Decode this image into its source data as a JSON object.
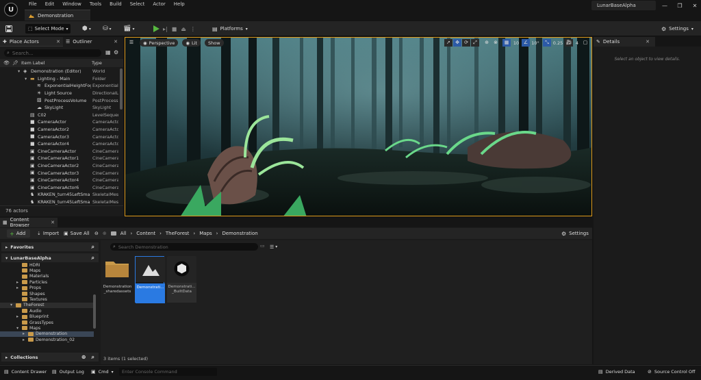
{
  "menu": [
    "File",
    "Edit",
    "Window",
    "Tools",
    "Build",
    "Select",
    "Actor",
    "Help"
  ],
  "doc_tab": "Demonstration",
  "project_name": "LunarBaseAlpha",
  "toolbar": {
    "select_mode": "Select Mode",
    "platforms": "Platforms",
    "settings": "Settings"
  },
  "left_tabs": {
    "place_actors": "Place Actors",
    "outliner": "Outliner"
  },
  "outliner": {
    "search_placeholder": "Search...",
    "col_label": "Item Label",
    "col_type": "Type",
    "rows": [
      {
        "label": "Demonstration (Editor)",
        "type": "World",
        "depth": 0,
        "icon": "world-icon"
      },
      {
        "label": "Lighting - Main",
        "type": "Folder",
        "depth": 1,
        "icon": "folder-icon"
      },
      {
        "label": "ExponentialHeightFog",
        "type": "ExponentialH",
        "depth": 2,
        "icon": "fog-icon"
      },
      {
        "label": "Light Source",
        "type": "DirectionalL",
        "depth": 2,
        "icon": "light-icon"
      },
      {
        "label": "PostProcessVolume",
        "type": "PostProcess",
        "depth": 2,
        "icon": "volume-icon"
      },
      {
        "label": "SkyLight",
        "type": "SkyLight",
        "depth": 2,
        "icon": "skylight-icon"
      },
      {
        "label": "C02",
        "type": "LevelSequen",
        "depth": 1,
        "icon": "sequence-icon"
      },
      {
        "label": "CameraActor",
        "type": "CameraActo",
        "depth": 1,
        "icon": "camera-icon"
      },
      {
        "label": "CameraActor2",
        "type": "CameraActo",
        "depth": 1,
        "icon": "camera-icon"
      },
      {
        "label": "CameraActor3",
        "type": "CameraActo",
        "depth": 1,
        "icon": "camera-icon"
      },
      {
        "label": "CameraActor4",
        "type": "CameraActo",
        "depth": 1,
        "icon": "camera-icon"
      },
      {
        "label": "CineCameraActor",
        "type": "CineCamera",
        "depth": 1,
        "icon": "cine-camera-icon"
      },
      {
        "label": "CineCameraActor1",
        "type": "CineCamera",
        "depth": 1,
        "icon": "cine-camera-icon"
      },
      {
        "label": "CineCameraActor2",
        "type": "CineCamera",
        "depth": 1,
        "icon": "cine-camera-icon"
      },
      {
        "label": "CineCameraActor3",
        "type": "CineCamera",
        "depth": 1,
        "icon": "cine-camera-icon"
      },
      {
        "label": "CineCameraActor4",
        "type": "CineCamera",
        "depth": 1,
        "icon": "cine-camera-icon"
      },
      {
        "label": "CineCameraActor6",
        "type": "CineCamera",
        "depth": 1,
        "icon": "cine-camera-icon"
      },
      {
        "label": "KRAKEN_turn45LeftSma",
        "type": "SkeletalMes",
        "depth": 1,
        "icon": "skeletal-mesh-icon"
      },
      {
        "label": "KRAKEN_turn45LeftSma",
        "type": "SkeletalMes",
        "depth": 1,
        "icon": "skeletal-mesh-icon"
      }
    ],
    "actor_count": "76 actors"
  },
  "viewport": {
    "perspective": "Perspective",
    "lit": "Lit",
    "show": "Show",
    "grid_snap": "10",
    "rotation_snap": "10°",
    "scale_snap": "0.25",
    "camera_speed": "4"
  },
  "details": {
    "tab": "Details",
    "empty_text": "Select an object to view details."
  },
  "content_browser": {
    "tab": "Content Browser",
    "add": "Add",
    "import": "Import",
    "save_all": "Save All",
    "breadcrumb": [
      "All",
      "Content",
      "TheForest",
      "Maps",
      "Demonstration"
    ],
    "settings": "Settings",
    "favorites": "Favorites",
    "project": "LunarBaseAlpha",
    "collections": "Collections",
    "tree": [
      {
        "label": "HDRI",
        "depth": 2,
        "arrow": false,
        "state": ""
      },
      {
        "label": "Maps",
        "depth": 2,
        "arrow": false,
        "state": ""
      },
      {
        "label": "Materials",
        "depth": 2,
        "arrow": false,
        "state": ""
      },
      {
        "label": "Particles",
        "depth": 2,
        "arrow": true,
        "state": ""
      },
      {
        "label": "Props",
        "depth": 2,
        "arrow": true,
        "state": ""
      },
      {
        "label": "Shapes",
        "depth": 2,
        "arrow": false,
        "state": ""
      },
      {
        "label": "Textures",
        "depth": 2,
        "arrow": false,
        "state": ""
      },
      {
        "label": "TheForest",
        "depth": 1,
        "arrow": "open",
        "state": "hl2"
      },
      {
        "label": "Audio",
        "depth": 2,
        "arrow": false,
        "state": ""
      },
      {
        "label": "Blueprint",
        "depth": 2,
        "arrow": true,
        "state": ""
      },
      {
        "label": "GrassTypes",
        "depth": 2,
        "arrow": false,
        "state": ""
      },
      {
        "label": "Maps",
        "depth": 2,
        "arrow": "open",
        "state": ""
      },
      {
        "label": "Demonstration",
        "depth": 3,
        "arrow": true,
        "state": "hl"
      },
      {
        "label": "Demonstration_02",
        "depth": 3,
        "arrow": true,
        "state": ""
      }
    ],
    "search_placeholder": "Search Demonstration",
    "assets": [
      {
        "caption1": "Demonstration",
        "caption2": "_sharedassets",
        "kind": "folder"
      },
      {
        "caption1": "Demonstrati...",
        "caption2": "",
        "kind": "level"
      },
      {
        "caption1": "Demonstrati...",
        "caption2": "_BuiltData",
        "kind": "builtdata"
      }
    ],
    "items_count": "3 items (1 selected)"
  },
  "statusbar": {
    "content_drawer": "Content Drawer",
    "output_log": "Output Log",
    "cmd": "Cmd",
    "console_placeholder": "Enter Console Command",
    "derived_data": "Derived Data",
    "source_control": "Source Control Off"
  }
}
